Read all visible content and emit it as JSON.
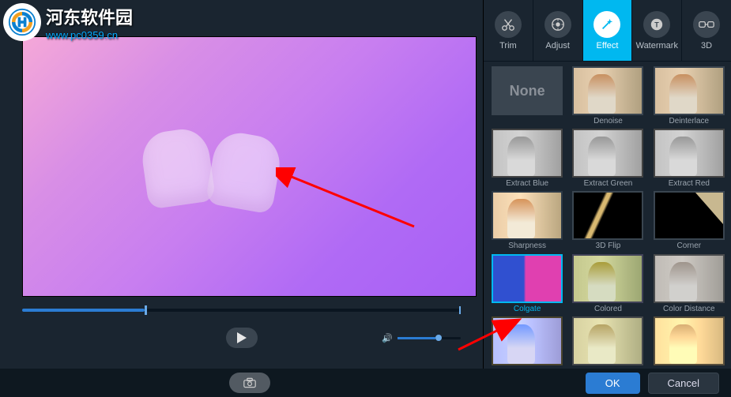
{
  "watermark": {
    "title": "河东软件园",
    "url": "www.pc0359.cn"
  },
  "tabs": {
    "trim": "Trim",
    "adjust": "Adjust",
    "effect": "Effect",
    "watermark": "Watermark",
    "threed": "3D"
  },
  "effects": {
    "none": "None",
    "denoise": "Denoise",
    "deinterlace": "Deinterlace",
    "extract_blue": "Extract Blue",
    "extract_green": "Extract Green",
    "extract_red": "Extract Red",
    "sharpness": "Sharpness",
    "flip3d": "3D Flip",
    "corner": "Corner",
    "colgate": "Colgate",
    "colored": "Colored",
    "color_distance": "Color Distance"
  },
  "buttons": {
    "ok": "OK",
    "cancel": "Cancel"
  },
  "playback": {
    "progress_percent": 28,
    "volume_percent": 60
  },
  "colors": {
    "accent": "#00b8f0",
    "primary_button": "#2b7cd3",
    "panel_bg": "#1a2530"
  }
}
